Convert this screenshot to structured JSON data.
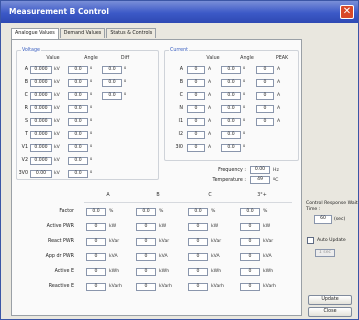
{
  "window": {
    "title": "Measurement B Control",
    "close": "✕"
  },
  "tabs": [
    "Analogue Values",
    "Demand Values",
    "Status & Controls"
  ],
  "voltage": {
    "label": "Voltage",
    "headers": [
      "Value",
      "Angle",
      "Diff"
    ],
    "rows": [
      {
        "name": "A",
        "value": "0.000",
        "unit": "kV",
        "angle": "0.0",
        "diff": "0.0"
      },
      {
        "name": "B",
        "value": "0.000",
        "unit": "kV",
        "angle": "0.0",
        "diff": "0.0"
      },
      {
        "name": "C",
        "value": "0.000",
        "unit": "kV",
        "angle": "0.0",
        "diff": "0.0"
      },
      {
        "name": "R",
        "value": "0.000",
        "unit": "kV",
        "angle": "0.0"
      },
      {
        "name": "S",
        "value": "0.000",
        "unit": "kV",
        "angle": "0.0"
      },
      {
        "name": "T",
        "value": "0.000",
        "unit": "kV",
        "angle": "0.0"
      },
      {
        "name": "V1",
        "value": "0.000",
        "unit": "kV",
        "angle": "0.0"
      },
      {
        "name": "V2",
        "value": "0.000",
        "unit": "kV",
        "angle": "0.0"
      },
      {
        "name": "3V0",
        "value": "0.00",
        "unit": "kV",
        "angle": "0.0"
      }
    ]
  },
  "current": {
    "label": "Current",
    "headers": [
      "Value",
      "Angle",
      "PEAK"
    ],
    "rows": [
      {
        "name": "A",
        "value": "0",
        "unit": "A",
        "angle": "0.0",
        "peak": "0",
        "peak_unit": "A"
      },
      {
        "name": "B",
        "value": "0",
        "unit": "A",
        "angle": "0.0",
        "peak": "0",
        "peak_unit": "A"
      },
      {
        "name": "C",
        "value": "0",
        "unit": "A",
        "angle": "0.0",
        "peak": "0",
        "peak_unit": "A"
      },
      {
        "name": "N",
        "value": "0",
        "unit": "A",
        "angle": "0.0",
        "peak": "0",
        "peak_unit": "A"
      },
      {
        "name": "I1",
        "value": "0",
        "unit": "A",
        "angle": "0.0",
        "peak": "0",
        "peak_unit": "A"
      },
      {
        "name": "I2",
        "value": "0",
        "unit": "A",
        "angle": "0.0"
      },
      {
        "name": "3I0",
        "value": "0",
        "unit": "A",
        "angle": "0.0"
      }
    ]
  },
  "frequency": {
    "label": "Frequency :",
    "value": "0.00",
    "unit": "Hz"
  },
  "temperature": {
    "label": "Temperature :",
    "value": "49",
    "unit": "ºC"
  },
  "angle_unit": "º",
  "power": {
    "columns": [
      "A",
      "B",
      "C",
      "3°+"
    ],
    "rows": [
      {
        "name": "Factor",
        "unit": "%",
        "value": "0.0"
      },
      {
        "name": "Active PWR",
        "unit": "kW",
        "value": "0"
      },
      {
        "name": "React PWR",
        "unit": "kVar",
        "value": "0"
      },
      {
        "name": "App dr PWR",
        "unit": "kVA",
        "value": "0"
      },
      {
        "name": "Active E",
        "unit": "kWh",
        "value": "0"
      },
      {
        "name": "Reactive E",
        "unit": "kVarh",
        "value": "0"
      }
    ]
  },
  "side": {
    "wait_label": "Control Response Wait Time :",
    "wait_value": "60",
    "wait_unit": "(sec)",
    "auto_update": "Auto Update",
    "interval": "1 sec",
    "update": "Update",
    "close": "Close"
  }
}
